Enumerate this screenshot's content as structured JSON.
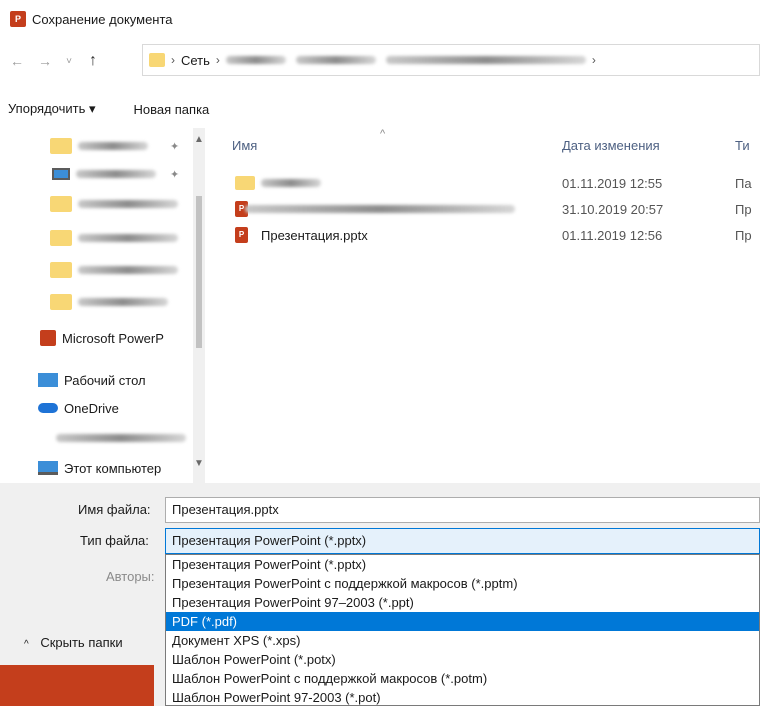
{
  "window": {
    "title": "Сохранение документа",
    "app_icon": "P"
  },
  "address": {
    "path_network": "Сеть"
  },
  "toolbar": {
    "sort_label": "Упорядочить ▾",
    "new_folder_label": "Новая папка"
  },
  "nav": {
    "items": [
      {
        "label": "Microsoft PowerP"
      },
      {
        "label": "Рабочий стол"
      },
      {
        "label": "OneDrive"
      },
      {
        "label": "Этот компьютер"
      }
    ]
  },
  "files": {
    "headers": {
      "name": "Имя",
      "date": "Дата изменения",
      "type": "Ти"
    },
    "rows": [
      {
        "name": "",
        "date": "01.11.2019 12:55",
        "type": "Па"
      },
      {
        "name": "",
        "date": "31.10.2019 20:57",
        "type": "Пр"
      },
      {
        "name": "Презентация.pptx",
        "date": "01.11.2019 12:56",
        "type": "Пр"
      }
    ]
  },
  "form": {
    "filename_label": "Имя файла:",
    "filename_value": "Презентация.pptx",
    "filetype_label": "Тип файла:",
    "filetype_value": "Презентация PowerPoint (*.pptx)",
    "authors_label": "Авторы:",
    "hide_folders_label": "Скрыть папки"
  },
  "dropdown": {
    "options": [
      "Презентация PowerPoint (*.pptx)",
      "Презентация PowerPoint с поддержкой макросов (*.pptm)",
      "Презентация PowerPoint 97–2003 (*.ppt)",
      "PDF (*.pdf)",
      "Документ XPS (*.xps)",
      "Шаблон PowerPoint (*.potx)",
      "Шаблон PowerPoint с поддержкой макросов (*.potm)",
      "Шаблон PowerPoint 97-2003 (*.pot)"
    ],
    "selected_option": "PDF (*.pdf)"
  },
  "colors": {
    "accent": "#0078d7",
    "ppt_red": "#c43e1c",
    "folder": "#f8d775"
  }
}
